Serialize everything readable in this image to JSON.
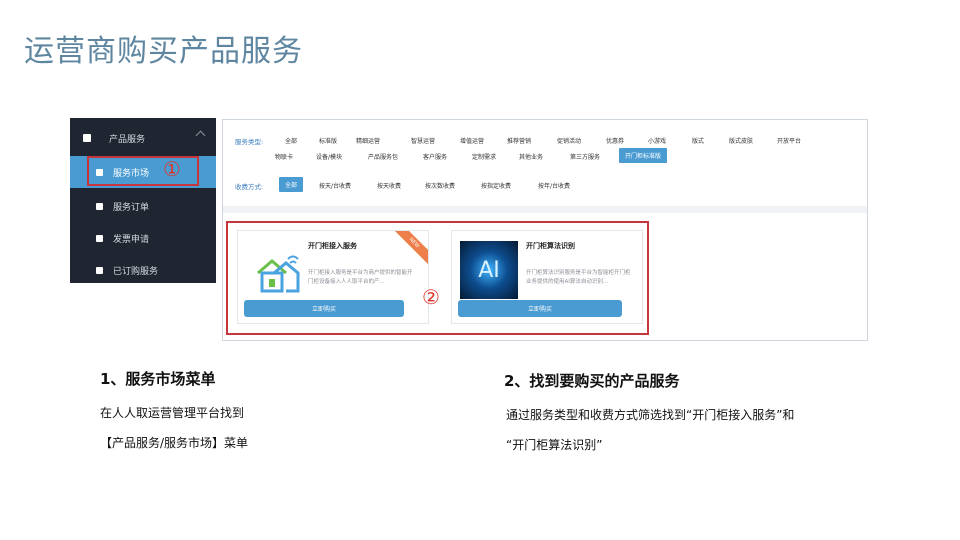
{
  "slide": {
    "title": "运营商购买产品服务"
  },
  "sidebar": {
    "parent_label": "产品服务",
    "items": [
      {
        "label": "服务市场",
        "active": true
      },
      {
        "label": "服务订单",
        "active": false
      },
      {
        "label": "发票申请",
        "active": false
      },
      {
        "label": "已订购服务",
        "active": false
      }
    ]
  },
  "markers": {
    "one": "①",
    "two": "②"
  },
  "filters": {
    "type_label": "服务类型:",
    "type_row1": [
      "全部",
      "标准版",
      "精细运营",
      "智慧运营",
      "增值运营",
      "推荐营销",
      "促销活动",
      "优惠券",
      "小游戏",
      "版式",
      "版式皮肤",
      "开放平台"
    ],
    "type_row2": [
      "物联卡",
      "设备/模块",
      "产品服务包",
      "客户服务",
      "定制需求",
      "其他业务",
      "第三方服务",
      "开门柜标准版"
    ],
    "charge_label": "收费方式:",
    "charge_items": [
      "全部",
      "按天/台收费",
      "按天收费",
      "按次数收费",
      "按指定收费",
      "按年/台收费"
    ]
  },
  "cards": [
    {
      "title": "开门柜接入服务",
      "desc": "开门柜接入服务是平台为商户提供的智能开门柜设备接入人人取平台的产...",
      "button": "立即购买",
      "badge": "NEW",
      "icon": "smart-home-icon"
    },
    {
      "title": "开门柜算法识别",
      "desc": "开门柜算法识别服务是平台为智能柜开门柜业务提供的使用AI算法自动识别...",
      "button": "立即购买",
      "image_text": "AI"
    }
  ],
  "steps": {
    "step1_title": "1、服务市场菜单",
    "step1_line1": "在人人取运营管理平台找到",
    "step1_line2": "【产品服务/服务市场】菜单",
    "step2_title": "2、找到要购买的产品服务",
    "step2_line1": "通过服务类型和收费方式筛选找到“开门柜接入服务”和",
    "step2_line2": "“开门柜算法识别”"
  },
  "colors": {
    "accent": "#4a9bd2",
    "highlight": "#c7353d",
    "title": "#5f86a0",
    "sidebar_bg": "#1f2631"
  }
}
